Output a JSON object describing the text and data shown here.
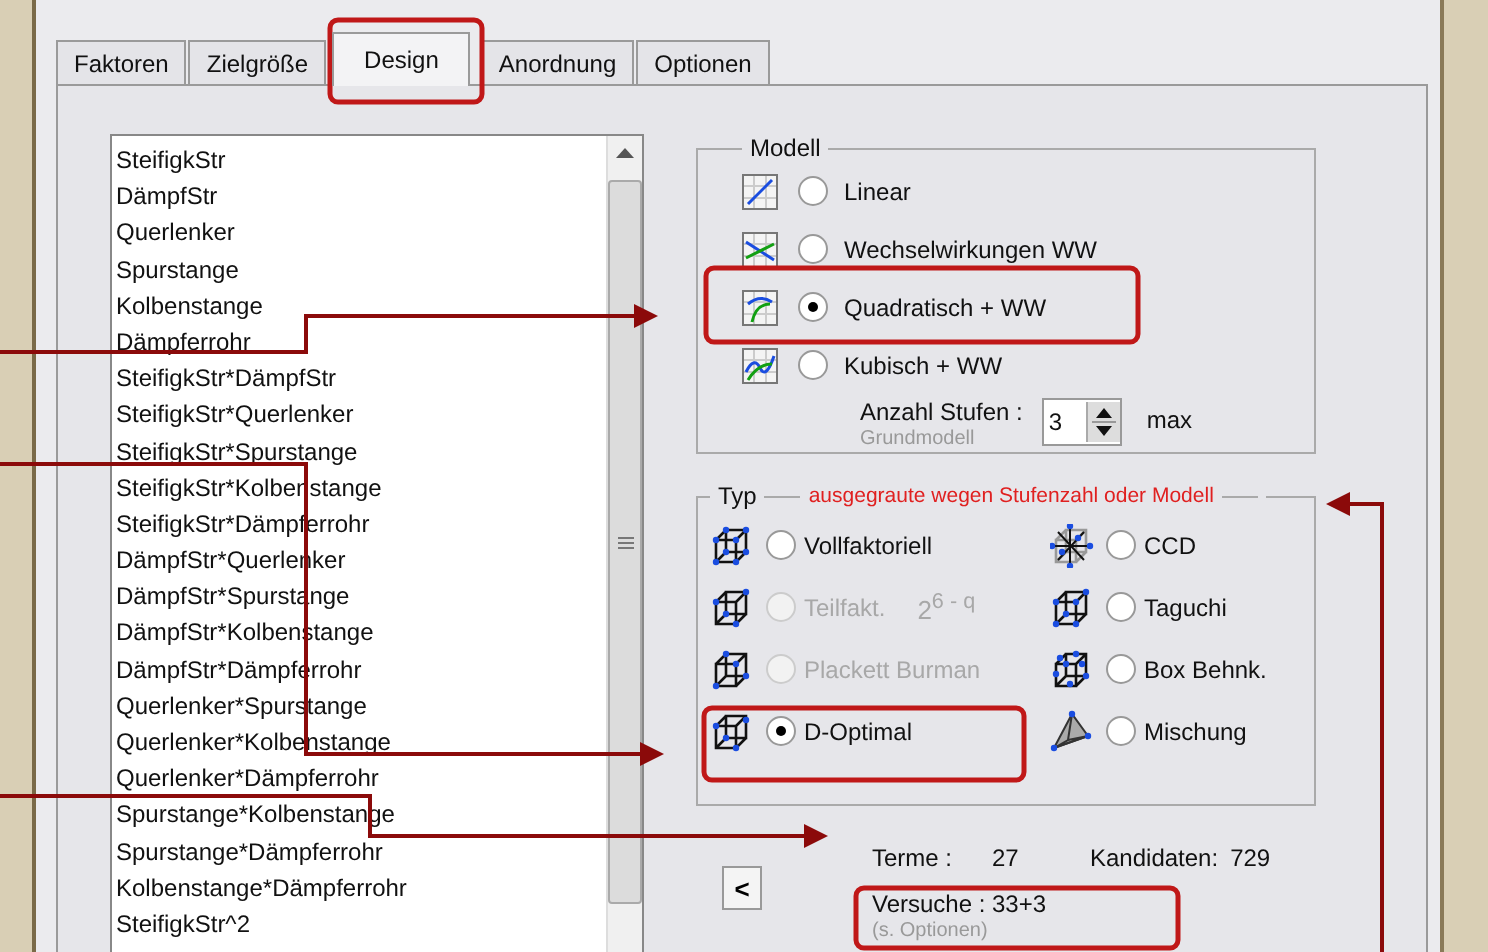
{
  "tabs": [
    {
      "label": "Faktoren",
      "selected": false
    },
    {
      "label": "Zielgröße",
      "selected": false
    },
    {
      "label": "Design",
      "selected": true
    },
    {
      "label": "Anordnung",
      "selected": false
    },
    {
      "label": "Optionen",
      "selected": false
    }
  ],
  "factor_list": {
    "items": [
      "SteifigkStr",
      "DämpfStr",
      "Querlenker",
      "Spurstange",
      "Kolbenstange",
      "Dämpferrohr",
      "SteifigkStr*DämpfStr",
      "SteifigkStr*Querlenker",
      "SteifigkStr*Spurstange",
      "SteifigkStr*Kolbenstange",
      "SteifigkStr*Dämpferrohr",
      "DämpfStr*Querlenker",
      "DämpfStr*Spurstange",
      "DämpfStr*Kolbenstange",
      "DämpfStr*Dämpferrohr",
      "Querlenker*Spurstange",
      "Querlenker*Kolbenstange",
      "Querlenker*Dämpferrohr",
      "Spurstange*Kolbenstange",
      "Spurstange*Dämpferrohr",
      "Kolbenstange*Dämpferrohr",
      "SteifigkStr^2"
    ]
  },
  "model_group": {
    "title": "Modell",
    "options": [
      {
        "label": "Linear",
        "selected": false
      },
      {
        "label": "Wechselwirkungen WW",
        "selected": false
      },
      {
        "label": "Quadratisch + WW",
        "selected": true
      },
      {
        "label": "Kubisch + WW",
        "selected": false
      }
    ],
    "levels": {
      "label": "Anzahl Stufen :",
      "hint": "Grundmodell",
      "value": "3",
      "suffix": "max"
    }
  },
  "type_group": {
    "title": "Typ",
    "note": "ausgegraute wegen Stufenzahl oder Modell",
    "options": [
      {
        "label": "Vollfaktoriell",
        "selected": false,
        "disabled": false
      },
      {
        "label": "Teilfakt.",
        "formula": "2$^{6 - q}$",
        "selected": false,
        "disabled": true
      },
      {
        "label": "Plackett Burman",
        "selected": false,
        "disabled": true
      },
      {
        "label": "D-Optimal",
        "selected": true,
        "disabled": false
      },
      {
        "label": "CCD",
        "selected": false,
        "disabled": false
      },
      {
        "label": "Taguchi",
        "selected": false,
        "disabled": false
      },
      {
        "label": "Box Behnk.",
        "selected": false,
        "disabled": false
      },
      {
        "label": "Mischung",
        "selected": false,
        "disabled": false
      }
    ]
  },
  "back_button": {
    "label": "<"
  },
  "summary": {
    "terms_label": "Terme :",
    "terms": "27",
    "candidates_label": "Kandidaten:",
    "candidates": "729",
    "runs_label": "Versuche :",
    "runs": "33+3",
    "runs_hint": "(s. Optionen)"
  }
}
